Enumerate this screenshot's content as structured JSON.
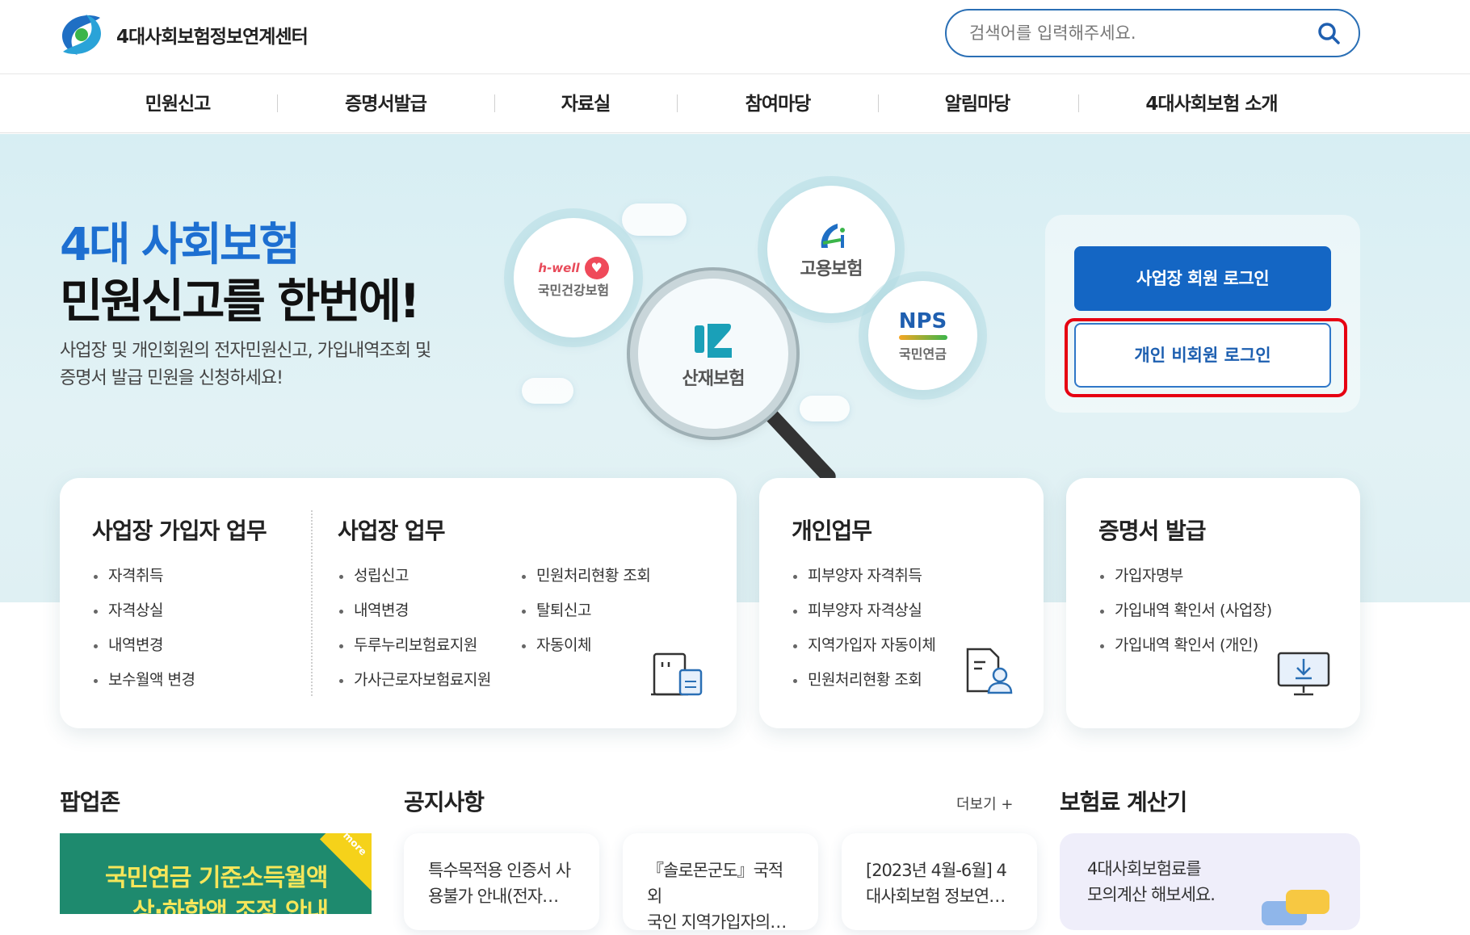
{
  "header": {
    "site_title": "4대사회보험정보연계센터",
    "search_placeholder": "검색어를 입력해주세요."
  },
  "nav": [
    "민원신고",
    "증명서발급",
    "자료실",
    "참여마당",
    "알림마당",
    "4대사회보험 소개"
  ],
  "hero": {
    "title_line1": "4대 사회보험",
    "title_line2": "민원신고를 한번에!",
    "desc_line1": "사업장 및 개인회원의 전자민원신고, 가입내역조회 및",
    "desc_line2": "증명서 발급 민원을 신청하세요!",
    "bubbles": {
      "health_brand": "h-well",
      "health_label": "국민건강보험",
      "employment_label": "고용보험",
      "accident_label": "산재보험",
      "pension_brand": "NPS",
      "pension_label": "국민연금"
    }
  },
  "login": {
    "business_label": "사업장 회원 로그인",
    "personal_label": "개인 비회원 로그인"
  },
  "cards": {
    "subscriber": {
      "title": "사업장 가입자 업무",
      "items": [
        "자격취득",
        "자격상실",
        "내역변경",
        "보수월액 변경"
      ]
    },
    "business": {
      "title": "사업장 업무",
      "items_col1": [
        "성립신고",
        "내역변경",
        "두루누리보험료지원",
        "가사근로자보험료지원"
      ],
      "items_col2": [
        "민원처리현황 조회",
        "탈퇴신고",
        "자동이체"
      ]
    },
    "personal": {
      "title": "개인업무",
      "items": [
        "피부양자 자격취득",
        "피부양자 자격상실",
        "지역가입자 자동이체",
        "민원처리현황 조회"
      ]
    },
    "certificate": {
      "title": "증명서 발급",
      "items": [
        "가입자명부",
        "가입내역 확인서 (사업장)",
        "가입내역 확인서 (개인)"
      ]
    }
  },
  "bottom": {
    "popup_title": "팝업존",
    "popup_banner_line1": "국민연금 기준소득월액",
    "popup_banner_line2": "상·하한액 조정 안내",
    "popup_ribbon": "more",
    "notice_title": "공지사항",
    "more_label": "더보기 +",
    "notices": [
      {
        "line1": "특수목적용 인증서 사",
        "line2": "용불가 안내(전자…"
      },
      {
        "line1": "『솔로몬군도』국적 외",
        "line2": "국인 지역가입자의…"
      },
      {
        "line1": "[2023년 4월-6월] 4",
        "line2": "대사회보험 정보연…"
      }
    ],
    "calc_title": "보험료 계산기",
    "calc_line1": "4대사회보험료를",
    "calc_line2": "모의계산 해보세요."
  },
  "colors": {
    "brand_blue": "#1466c4",
    "hero_bg": "#d7eef3",
    "highlight_red": "#e60012"
  }
}
